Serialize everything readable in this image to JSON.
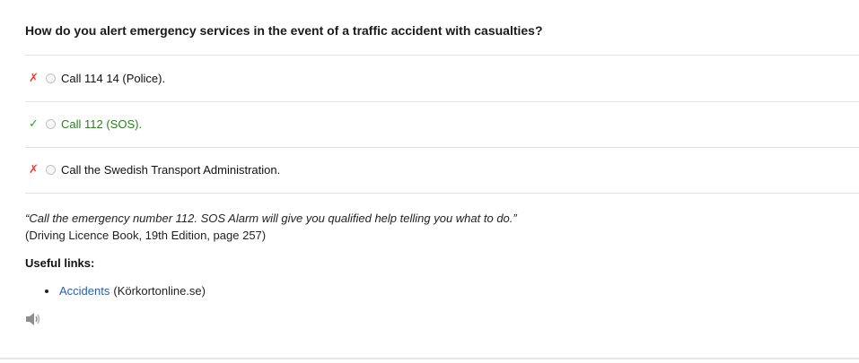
{
  "question": "How do you alert emergency services in the event of a traffic accident with casualties?",
  "answers": [
    {
      "mark": "✗",
      "status": "wrong",
      "text": "Call 114 14 (Police)."
    },
    {
      "mark": "✓",
      "status": "correct",
      "text": "Call 112 (SOS)."
    },
    {
      "mark": "✗",
      "status": "wrong",
      "text": "Call the Swedish Transport Administration."
    }
  ],
  "explanation": {
    "quote": "“Call the emergency number 112. SOS Alarm will give you qualified help telling you what to do.”",
    "source": "(Driving Licence Book, 19th Edition, page 257)"
  },
  "useful_links": {
    "title": "Useful links:",
    "items": [
      {
        "label": "Accidents",
        "suffix": "(Körkortonline.se)"
      }
    ]
  },
  "audio": {
    "icon": "speaker-icon"
  },
  "colors": {
    "wrong": "#e0453a",
    "correct": "#3a9a2e",
    "link": "#2a5db0"
  }
}
